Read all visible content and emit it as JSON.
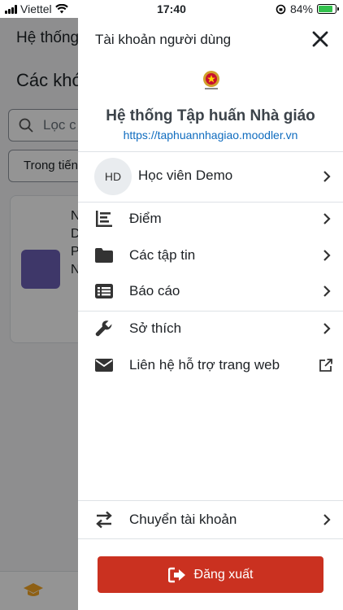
{
  "status_bar": {
    "carrier": "Viettel",
    "time": "17:40",
    "battery": "84%",
    "battery_level": 0.84
  },
  "background": {
    "header": "Hệ thống",
    "title": "Các khó",
    "search_placeholder": "Lọc c",
    "filter_label": "Trong tiến",
    "card_lines": [
      "N",
      "D",
      "P",
      "N"
    ]
  },
  "drawer": {
    "title": "Tài khoản người dùng",
    "site_name": "Hệ thống Tập huấn Nhà giáo",
    "site_url": "https://taphuannhagiao.moodler.vn",
    "user": {
      "initials": "HD",
      "name": "Học viên Demo"
    },
    "menu": [
      {
        "label": "Điểm",
        "icon": "grades-icon"
      },
      {
        "label": "Các tập tin",
        "icon": "folder-icon"
      },
      {
        "label": "Báo cáo",
        "icon": "reports-icon"
      },
      {
        "label": "Sở thích",
        "icon": "wrench-icon"
      },
      {
        "label": "Liên hệ hỗ trợ trang web",
        "icon": "envelope-icon"
      }
    ],
    "switch_account": "Chuyển tài khoản",
    "logout": "Đăng xuất"
  },
  "colors": {
    "accent": "#0f6cbf",
    "danger": "#ca3120",
    "battery": "#33c24d"
  }
}
